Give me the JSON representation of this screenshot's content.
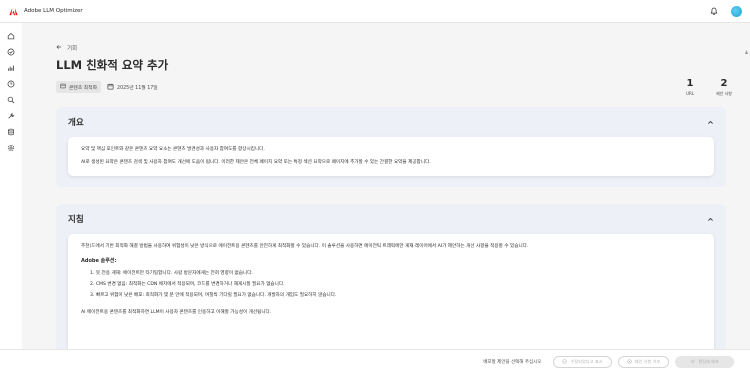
{
  "app": {
    "title": "Adobe LLM Optimizer",
    "brand_color": "#eb1000"
  },
  "header": {
    "notifications_icon": "bell-icon",
    "avatar_color": "#1ba3d4"
  },
  "rail": {
    "items": [
      {
        "icon": "home-icon"
      },
      {
        "icon": "check-circle-icon"
      },
      {
        "icon": "bar-chart-icon"
      },
      {
        "icon": "history-icon"
      },
      {
        "icon": "search-icon"
      },
      {
        "icon": "tools-icon"
      },
      {
        "icon": "database-icon"
      },
      {
        "icon": "settings-icon"
      }
    ]
  },
  "page": {
    "back_label": "기회",
    "title": "LLM 친화적 요약 추가",
    "tag_label": "콘텐츠 최적화",
    "date": "2025년 11월 17일",
    "stats": [
      {
        "value": "1",
        "label": "URL"
      },
      {
        "value": "2",
        "label": "제안 사항"
      }
    ]
  },
  "overview": {
    "title": "개요",
    "paragraphs": [
      "요약 및 핵심 포인트와 같은 콘텐츠 요약 요소는 콘텐츠 발견성과 사용자 참여도를 향상시킵니다.",
      "AI로 생성된 요약은 콘텐츠 검색 및 사용자 참여도 개선에 도움이 됩니다. 이러한 제안은 전체 페이지 요약 또는 특정 섹션 요약으로 페이지에 추가할 수 있는 간결한 요약을 제공합니다."
    ]
  },
  "guidelines": {
    "title": "지침",
    "intro": "추천(드에서 기반 최적화 해결 방법을 사용하여 위험성이 낮은 방식으로 에이전트용 콘텐츠를 안전하게 최적화할 수 있습니다. 이 솔루션을 사용하면 에이전틱 트래픽에만 게재 레이어에서 AI가 제안하는 개선 사항을 적용할 수 있습니다.",
    "solution_title": "Adobe 솔루션:",
    "solution_items": [
      "1. 봇 전용 게재: 에이전트만 타기팅합니다. 사람 방문자에게는 전혀 영향이 없습니다.",
      "2. CMS 변경 없음: 최적화는 CDN 에지에서 적용되며, 코드를 변경하거나 재게시할 필요가 없습니다.",
      "3. 빠르고 위험이 낮은 배포: 최적화가 몇 분 안에 적용되며, 며칠씩 기다릴 필요가 없습니다. 개발자의 개입도 필요하지 않습니다."
    ],
    "outro": "AI 에이전트용 콘텐츠를 최적화하면 LLM이 사용자 콘텐츠를 인용하고 이해할 가능성이 개선됩니다."
  },
  "footer": {
    "hint": "배포할 제안을 선택해 주십시오",
    "buttons": [
      {
        "label": "수정되었다고 표시",
        "icon": "check-circle-icon"
      },
      {
        "label": "제안 사항 거부",
        "icon": "close-circle-icon"
      },
      {
        "label": "편집에 배포",
        "icon": "send-icon"
      }
    ]
  }
}
